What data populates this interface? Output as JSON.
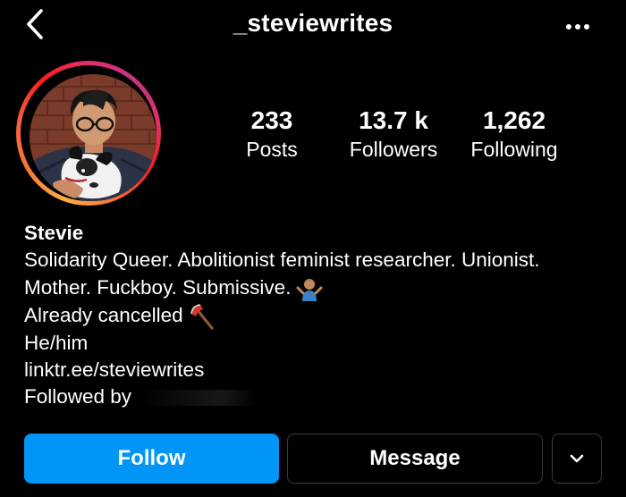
{
  "header": {
    "username": "_steviewrites",
    "back_icon": "chevron-left-icon",
    "more_icon": "more-horizontal-icon"
  },
  "stats": {
    "posts": {
      "value": "233",
      "label": "Posts"
    },
    "followers": {
      "value": "13.7 k",
      "label": "Followers"
    },
    "following": {
      "value": "1,262",
      "label": "Following"
    }
  },
  "bio": {
    "name": "Stevie",
    "line1": "Solidarity Queer. Abolitionist feminist researcher. Unionist.",
    "line2": "Mother. Fuckboy. Submissive.",
    "line2_emoji": "person-shrugging-emoji",
    "line3": "Already cancelled",
    "line3_emoji": "axe-emoji",
    "line4": "He/him",
    "link": "linktr.ee/steviewrites",
    "followed_by_label": "Followed by"
  },
  "actions": {
    "follow_label": "Follow",
    "message_label": "Message",
    "dropdown_icon": "chevron-down-icon"
  },
  "colors": {
    "background": "#000000",
    "follow_button": "#0095f6",
    "button_border": "#3a3a3a",
    "story_ring": [
      "#fcaf45",
      "#f77737",
      "#fd1d1d",
      "#e1306c",
      "#c13584"
    ]
  }
}
